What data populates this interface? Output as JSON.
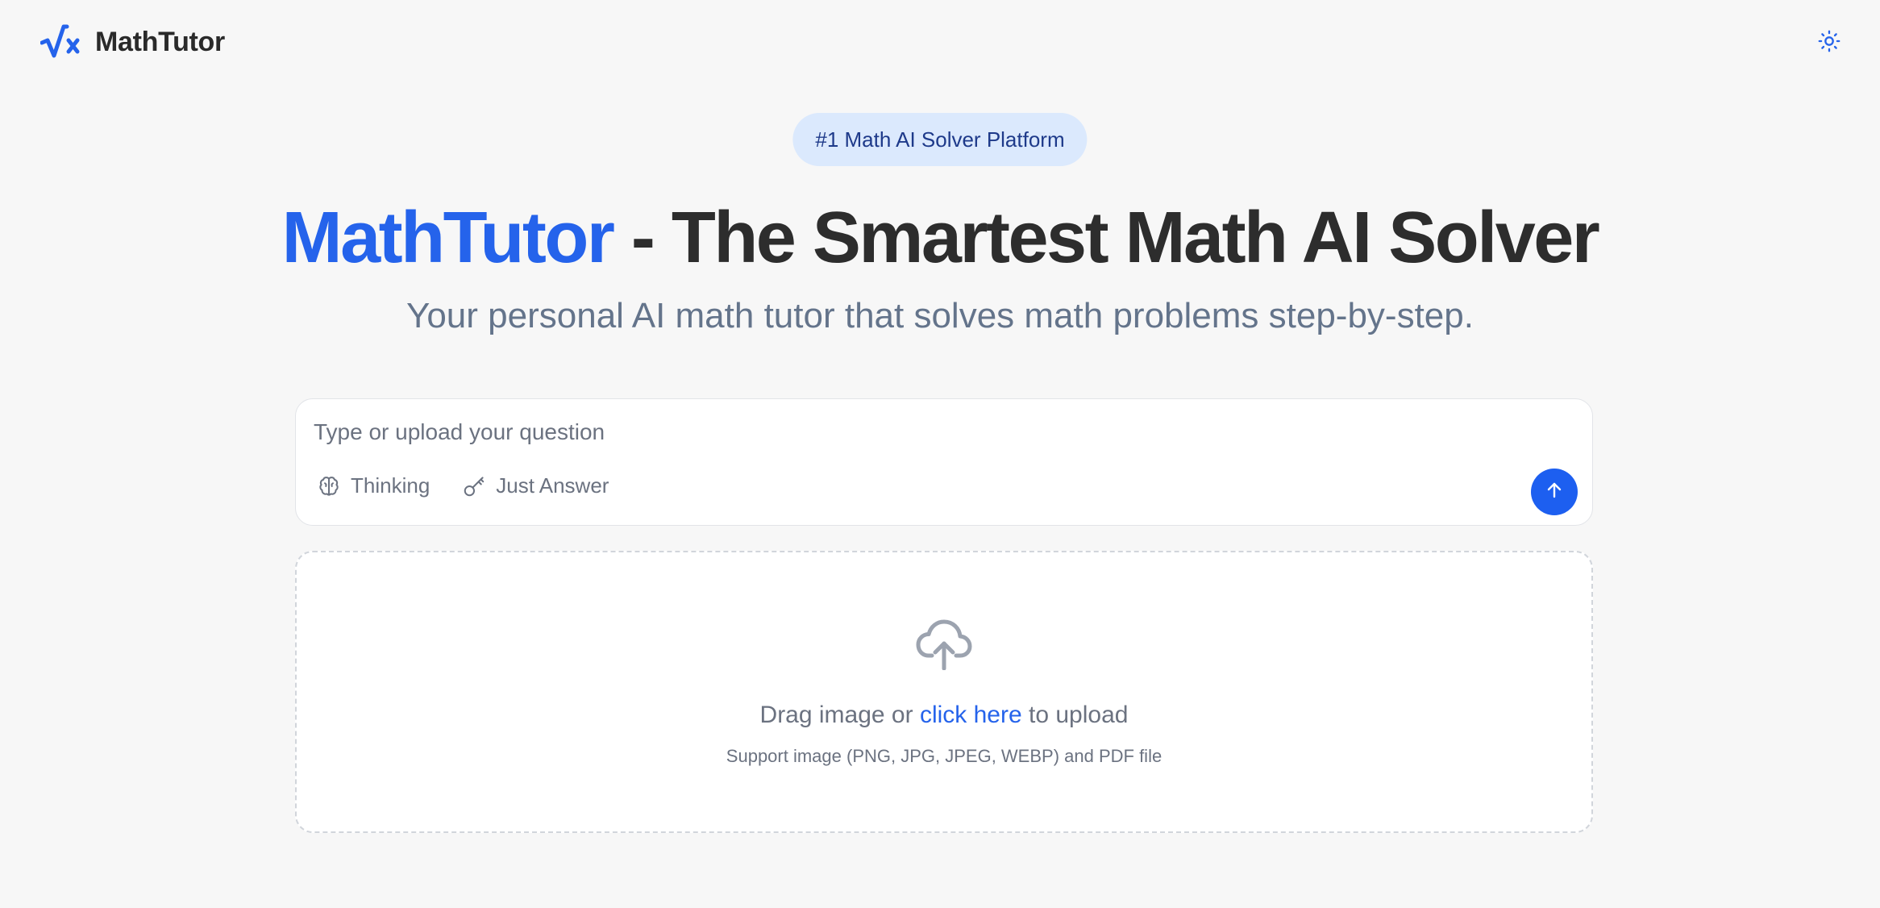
{
  "header": {
    "logo_text": "MathTutor",
    "logo_icon": "square-root-x-icon",
    "theme_toggle_icon": "sun-icon"
  },
  "badge": {
    "text": "#1 Math AI Solver Platform"
  },
  "hero": {
    "title_brand": "MathTutor",
    "title_rest": " - The Smartest Math AI Solver",
    "subtitle": "Your personal AI math tutor that solves math problems step-by-step."
  },
  "question": {
    "placeholder": "Type or upload your question",
    "value": "",
    "modes": [
      {
        "label": "Thinking",
        "icon": "brain-icon"
      },
      {
        "label": "Just Answer",
        "icon": "key-icon"
      }
    ],
    "send_icon": "arrow-up-icon"
  },
  "upload": {
    "icon": "cloud-upload-icon",
    "text_before": "Drag image or ",
    "link_text": "click here",
    "text_after": " to upload",
    "support_text": "Support image (PNG, JPG, JPEG, WEBP) and PDF file"
  },
  "colors": {
    "accent": "#2563eb",
    "send_button": "#1d5ff0",
    "badge_bg": "#dbe9fd",
    "badge_text": "#1e3a8a",
    "background": "#f7f7f7",
    "title_text": "#2d2d2d",
    "subtitle_text": "#64748b"
  }
}
